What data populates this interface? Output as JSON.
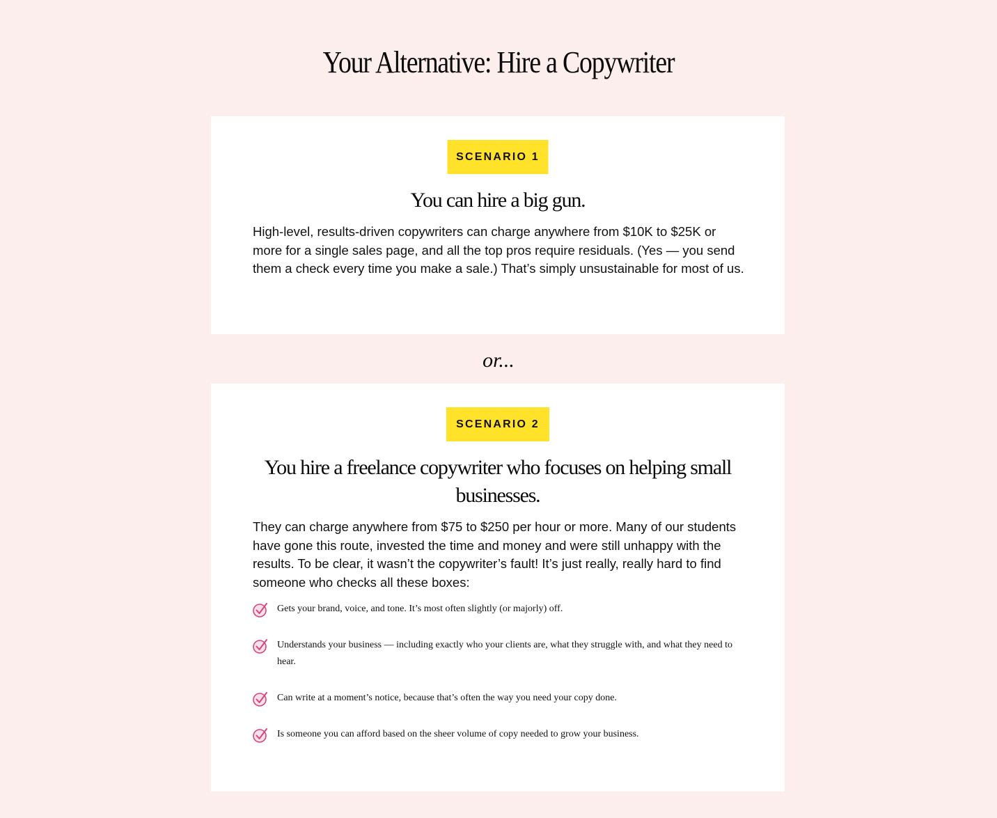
{
  "page": {
    "title": "Your Alternative: Hire a Copywriter",
    "separator": "or..."
  },
  "scenario1": {
    "badge": "SCENARIO 1",
    "heading": "You can hire a big gun.",
    "body": "High-level, results-driven copywriters can charge anywhere from $10K to $25K or more for a single sales page, and all the top pros require residuals. (Yes — you send them a check every time you make a sale.) That’s simply unsustainable for most of us."
  },
  "scenario2": {
    "badge": "SCENARIO 2",
    "heading": "You hire a freelance copywriter who focuses on helping small businesses.",
    "body": "They can charge anywhere from $75 to $250 per hour or more. Many of our students have gone this route, invested the time and money and were still unhappy with the results. To be clear, it wasn’t the copywriter’s fault! It’s just really, really hard to find someone who checks all these boxes:",
    "checklist": [
      {
        "icon": "check-circle-icon",
        "text": "Gets your brand, voice, and tone. It’s most often slightly (or majorly) off."
      },
      {
        "icon": "check-circle-icon",
        "text": "Understands your business — including exactly who your clients are, what they struggle with, and what they need to hear."
      },
      {
        "icon": "check-circle-icon",
        "text": "Can write at a moment’s notice, because that’s often the way you need your copy done."
      },
      {
        "icon": "check-circle-icon",
        "text": "Is someone you can afford based on the sheer volume of copy needed to grow your business."
      }
    ]
  },
  "colors": {
    "background": "#fdeeee",
    "card": "#ffffff",
    "badge": "#ffe229",
    "check_icon": "#d6467e"
  }
}
